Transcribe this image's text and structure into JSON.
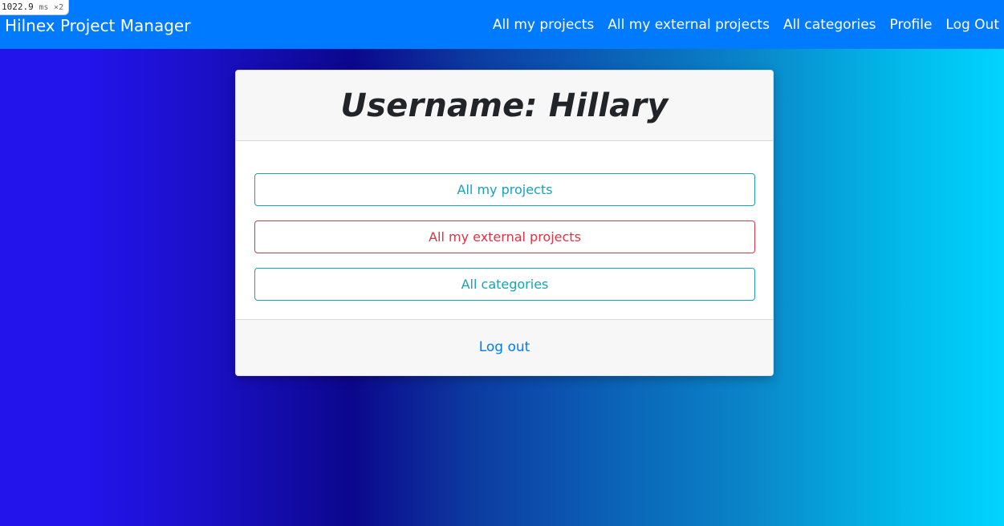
{
  "perf": {
    "time": "1022.9",
    "unit": "ms",
    "multiplier": "×2"
  },
  "navbar": {
    "brand": "Hilnex Project Manager",
    "links": [
      "All my projects",
      "All my external projects",
      "All categories",
      "Profile",
      "Log Out"
    ]
  },
  "card": {
    "title": "Username: Hillary",
    "buttons": [
      {
        "label": "All my projects",
        "style": "info"
      },
      {
        "label": "All my external projects",
        "style": "danger"
      },
      {
        "label": "All categories",
        "style": "info"
      }
    ],
    "footer_link": "Log out"
  },
  "colors": {
    "navbar": "#007bff",
    "info": "#17a2b8",
    "danger": "#dc3545",
    "link": "#007bff",
    "gradient": [
      "#2314ec",
      "#0c078d",
      "#00d4ff"
    ]
  }
}
